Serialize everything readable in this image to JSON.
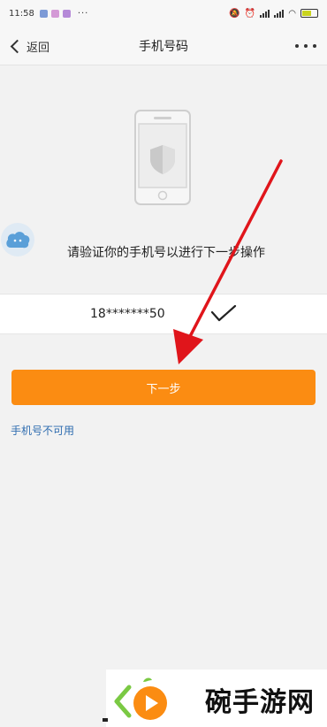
{
  "status_bar": {
    "time": "11:58",
    "dots": "···",
    "battery_level": 0.64
  },
  "nav": {
    "back_label": "返回",
    "title": "手机号码"
  },
  "prompt_text": "请验证你的手机号以进行下一步操作",
  "phone_number": "18*******50",
  "next_button_label": "下一步",
  "unavailable_link": "手机号不可用",
  "watermark_text": "碗手游网",
  "colors": {
    "accent": "#fb8c12",
    "link": "#2f6db0",
    "annotation_arrow": "#e0151b"
  }
}
